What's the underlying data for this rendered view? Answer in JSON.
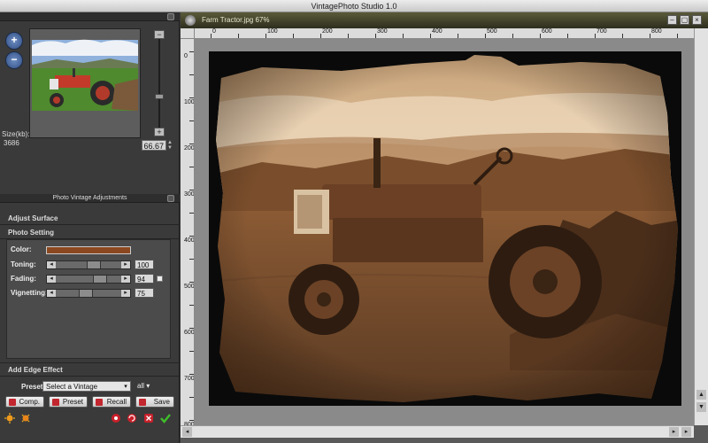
{
  "window": {
    "title": "VintagePhoto Studio 1.0"
  },
  "navigator": {
    "size_label": "Size(kb):",
    "size_value": "3686",
    "zoom_value": "66.67",
    "zoom_in_glyph": "+",
    "zoom_out_glyph": "−",
    "slider_plus": "+",
    "slider_minus": "−"
  },
  "adjustments": {
    "header": "Photo Vintage Adjustments",
    "sections": {
      "adjust_surface": "Adjust Surface",
      "photo_setting": "Photo Setting",
      "edge_effect": "Add Edge Effect"
    },
    "color_label": "Color:",
    "color_value": "#8b4820",
    "sliders": [
      {
        "label": "Toning:",
        "value": "100",
        "level": 0.6
      },
      {
        "label": "Fading:",
        "value": "94",
        "level": 0.72
      },
      {
        "label": "Vignetting:",
        "value": "75",
        "level": 0.45
      }
    ]
  },
  "edge": {
    "preset_label": "Preset:",
    "preset_value": "Select a Vintage",
    "filter_value": "all",
    "buttons": {
      "comp": "Comp.",
      "preset": "Preset",
      "recall": "Recall",
      "save": "Save"
    }
  },
  "document": {
    "title": "Farm Tractor.jpg 67%",
    "ruler_h": [
      "0",
      "50",
      "100",
      "150",
      "200",
      "250",
      "300",
      "350",
      "400",
      "450",
      "500",
      "550",
      "600",
      "650",
      "700",
      "750",
      "800",
      "850",
      "900",
      "950",
      "1000",
      "1050",
      "1100",
      "1150",
      "1200"
    ],
    "ruler_v_labels": [
      "0",
      "5",
      "1 0 0",
      "1 5 0",
      "2 0 0",
      "2 5 0",
      "3 0 0",
      "3 5 0",
      "4 0 0",
      "4 5 0",
      "5 0 0",
      "5 5 0",
      "6 0 0",
      "6 5 0",
      "7 0 0",
      "7 5 0",
      "8 0 0"
    ]
  },
  "colors": {
    "accent": "#8b4820",
    "sepia_dark": "#3b2414",
    "sepia_light": "#d8b48c"
  }
}
